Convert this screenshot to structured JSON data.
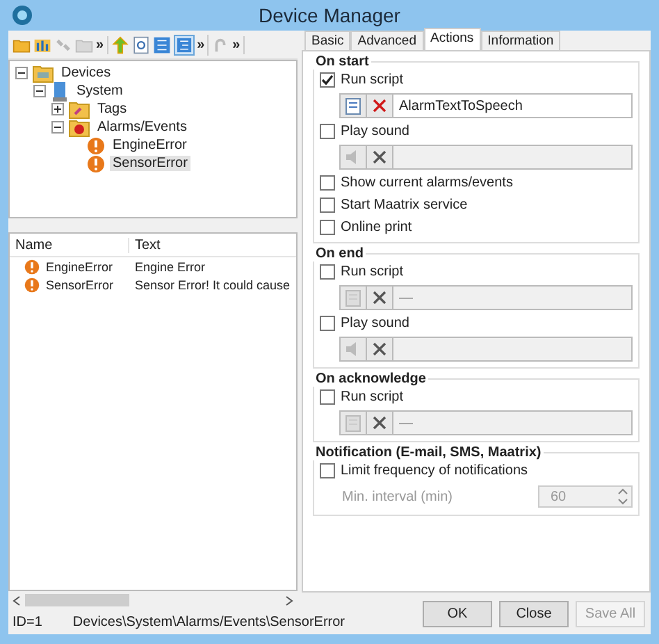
{
  "window": {
    "title": "Device Manager"
  },
  "toolbar": {
    "groups": [
      {
        "overflow": "»"
      },
      {
        "overflow": "»"
      },
      {
        "overflow": "»"
      }
    ]
  },
  "tree": [
    {
      "label": "Devices",
      "kind": "root",
      "expanded": true,
      "selected": false,
      "children": [
        {
          "label": "System",
          "kind": "device",
          "expanded": true,
          "selected": false,
          "children": [
            {
              "label": "Tags",
              "kind": "folder",
              "expanded": false,
              "selected": false
            },
            {
              "label": "Alarms/Events",
              "kind": "alarm-folder",
              "expanded": true,
              "selected": false,
              "children": [
                {
                  "label": "EngineError",
                  "kind": "alarm",
                  "selected": false
                },
                {
                  "label": "SensorError",
                  "kind": "alarm",
                  "selected": true
                }
              ]
            }
          ]
        }
      ]
    }
  ],
  "list": {
    "columns": [
      "Name",
      "Text"
    ],
    "rows": [
      {
        "name": "EngineError",
        "text": "Engine Error"
      },
      {
        "name": "SensorError",
        "text": "Sensor Error! It could cause"
      }
    ]
  },
  "status_bar": {
    "id": "ID=1",
    "path": "Devices\\System\\Alarms/Events\\SensorError"
  },
  "tabs": [
    {
      "label": "Basic",
      "selected": false
    },
    {
      "label": "Advanced",
      "selected": false
    },
    {
      "label": "Actions",
      "selected": true
    },
    {
      "label": "Information",
      "selected": false
    }
  ],
  "sections": [
    {
      "title": "On start",
      "items": [
        {
          "kind": "checkbox",
          "label": "Run script",
          "checked": true
        },
        {
          "kind": "script",
          "value": "AlarmTextToSpeech",
          "disabled": false
        },
        {
          "kind": "checkbox",
          "label": "Play sound",
          "checked": false
        },
        {
          "kind": "sound",
          "disabled": true
        },
        {
          "kind": "checkbox",
          "label": "Show current alarms/events",
          "checked": false
        },
        {
          "kind": "checkbox",
          "label": "Start Maatrix service",
          "checked": false
        },
        {
          "kind": "checkbox",
          "label": "Online print",
          "checked": false
        }
      ]
    },
    {
      "title": "On end",
      "items": [
        {
          "kind": "checkbox",
          "label": "Run script",
          "checked": false
        },
        {
          "kind": "script",
          "value": "—",
          "disabled": true
        },
        {
          "kind": "checkbox",
          "label": "Play sound",
          "checked": false
        },
        {
          "kind": "sound",
          "disabled": true
        }
      ]
    },
    {
      "title": "On acknowledge",
      "items": [
        {
          "kind": "checkbox",
          "label": "Run script",
          "checked": false
        },
        {
          "kind": "script",
          "value": "—",
          "disabled": true
        }
      ]
    },
    {
      "title": "Notification (E-mail, SMS, Maatrix)",
      "items": [
        {
          "kind": "checkbox",
          "label": "Limit frequency of notifications",
          "checked": false
        },
        {
          "kind": "number",
          "label": "Min. interval (min)",
          "value": "60",
          "disabled": true
        }
      ]
    }
  ],
  "buttons": [
    {
      "label": "OK",
      "disabled": false
    },
    {
      "label": "Close",
      "disabled": false
    },
    {
      "label": "Save All",
      "disabled": true
    }
  ]
}
